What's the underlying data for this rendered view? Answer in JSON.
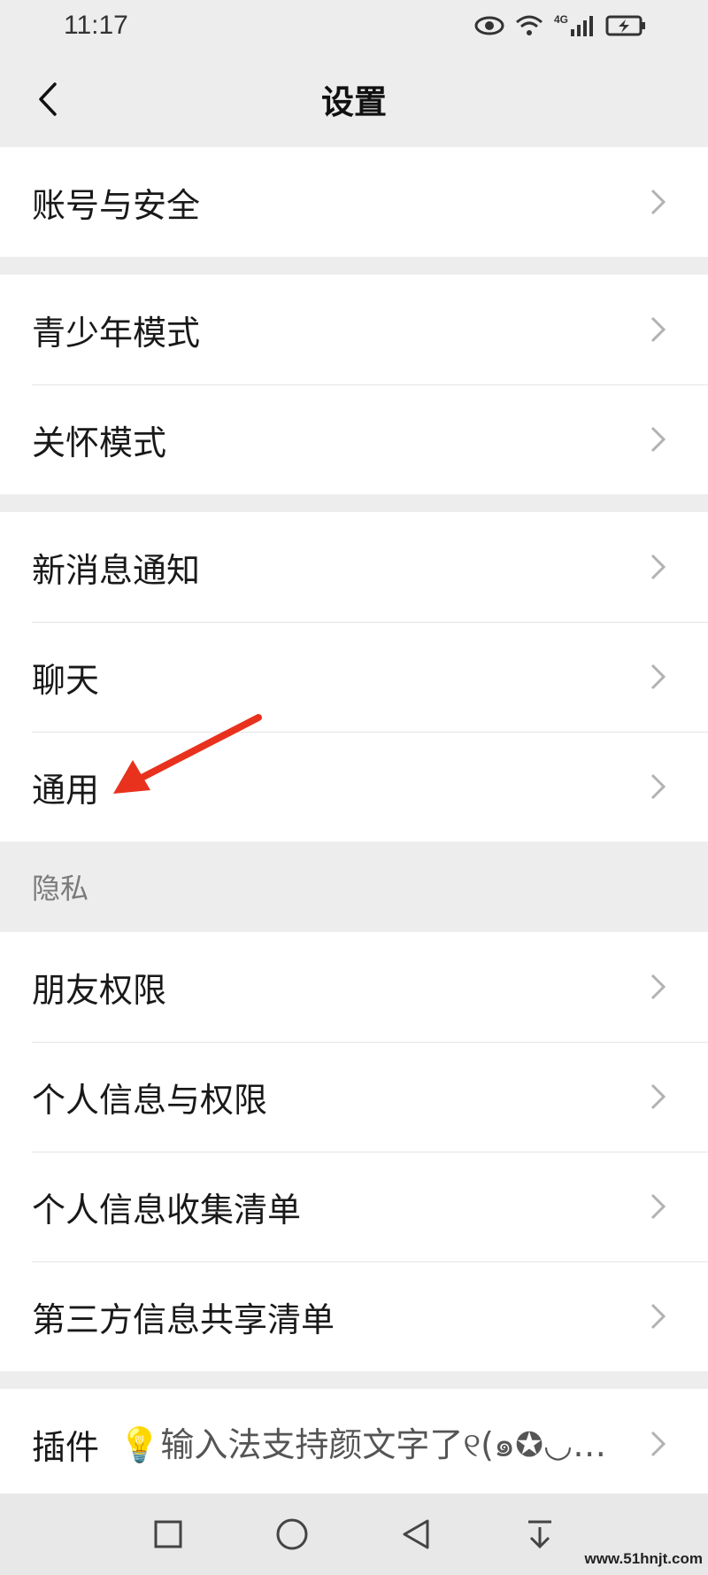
{
  "status_bar": {
    "time": "11:17",
    "network": "4G"
  },
  "nav": {
    "title": "设置"
  },
  "groups": [
    {
      "rows": [
        "账号与安全"
      ]
    },
    {
      "rows": [
        "青少年模式",
        "关怀模式"
      ]
    },
    {
      "rows": [
        "新消息通知",
        "聊天",
        "通用"
      ]
    }
  ],
  "privacy": {
    "header": "隐私",
    "rows": [
      "朋友权限",
      "个人信息与权限",
      "个人信息收集清单",
      "第三方信息共享清单"
    ]
  },
  "plugins": {
    "label": "插件",
    "extra": "💡输入法支持颜文字了୧(๑✪◡…"
  },
  "annotation_arrow_color": "#e8321e",
  "watermark": "www.51hnjt.com"
}
